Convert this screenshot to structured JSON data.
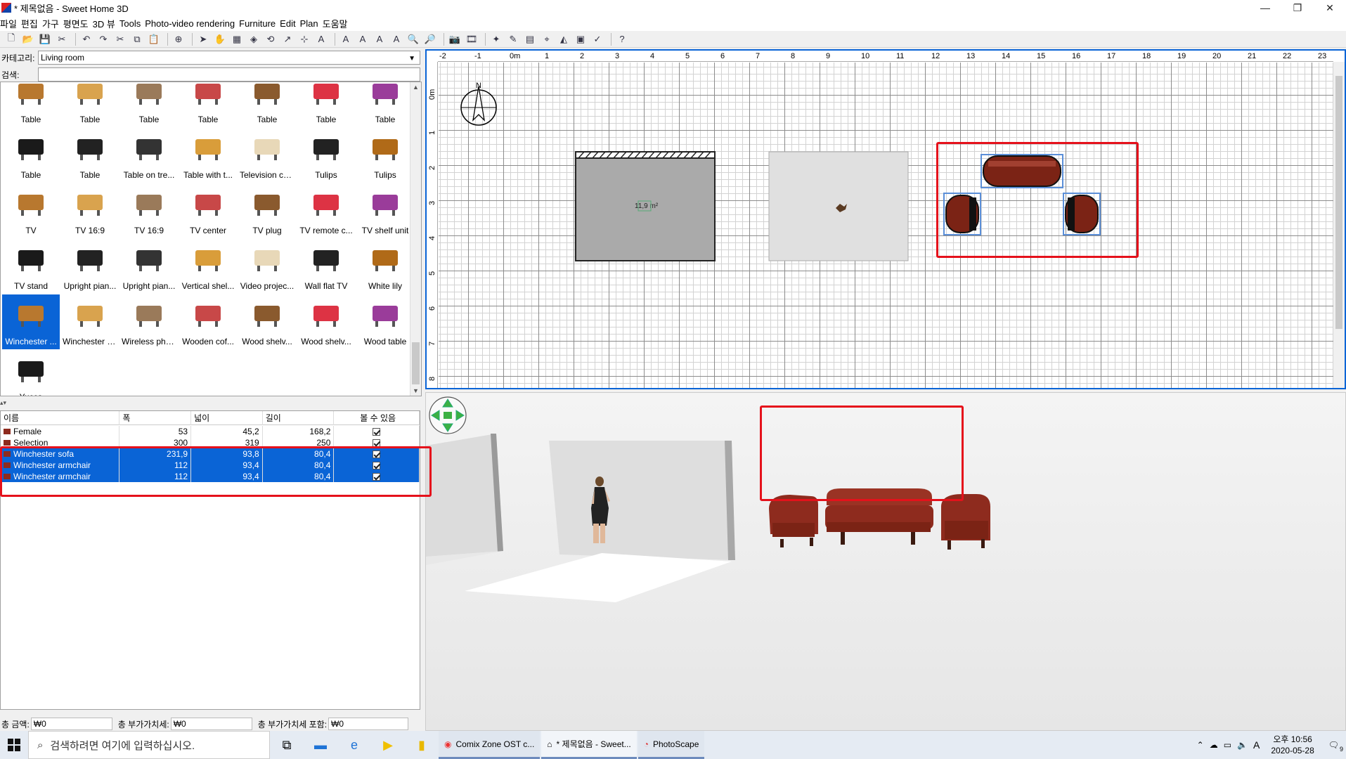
{
  "window": {
    "title": "* 제목없음 - Sweet Home 3D",
    "minimize": "—",
    "maximize": "❐",
    "close": "✕"
  },
  "menu": [
    "파일",
    "편집",
    "가구",
    "평면도",
    "3D 뷰",
    "Tools",
    "Photo-video rendering",
    "Furniture",
    "Edit",
    "Plan",
    "도움말"
  ],
  "left": {
    "category_label": "카테고리:",
    "category_value": "Living room",
    "search_label": "검색:",
    "search_value": ""
  },
  "catalog": [
    "Table",
    "Table",
    "Table",
    "Table",
    "Table",
    "Table",
    "Table",
    "Table",
    "Table",
    "Table on tre...",
    "Table with t...",
    "Television ca...",
    "Tulips",
    "Tulips",
    "TV",
    "TV 16:9",
    "TV 16:9",
    "TV center",
    "TV plug",
    "TV remote c...",
    "TV shelf unit",
    "TV stand",
    "Upright pian...",
    "Upright pian...",
    "Vertical shel...",
    "Video projec...",
    "Wall flat TV",
    "White lily",
    "Winchester ...",
    "Winchester s...",
    "Wireless pho...",
    "Wooden cof...",
    "Wood shelv...",
    "Wood shelv...",
    "Wood table",
    "Yucca"
  ],
  "catalog_selected_index": 28,
  "furniture_table": {
    "headers": [
      "이름",
      "폭",
      "넓이",
      "길이",
      "볼 수 있음"
    ],
    "rows": [
      {
        "name": "Female",
        "width": "53",
        "depth": "45,2",
        "height": "168,2",
        "visible": true,
        "selected": false
      },
      {
        "name": "Selection",
        "width": "300",
        "depth": "319",
        "height": "250",
        "visible": true,
        "selected": false
      },
      {
        "name": "Winchester sofa",
        "width": "231,9",
        "depth": "93,8",
        "height": "80,4",
        "visible": true,
        "selected": true
      },
      {
        "name": "Winchester armchair",
        "width": "112",
        "depth": "93,4",
        "height": "80,4",
        "visible": true,
        "selected": true
      },
      {
        "name": "Winchester armchair",
        "width": "112",
        "depth": "93,4",
        "height": "80,4",
        "visible": true,
        "selected": true
      }
    ]
  },
  "status": [
    {
      "label": "총 금액:",
      "value": "₩0"
    },
    {
      "label": "총 부가가치세:",
      "value": "₩0"
    },
    {
      "label": "총 부가가치세 포함:",
      "value": "₩0"
    }
  ],
  "plan": {
    "x_ticks": [
      "-2",
      "-1",
      "0m",
      "1",
      "2",
      "3",
      "4",
      "5",
      "6",
      "7",
      "8",
      "9",
      "10",
      "11",
      "12",
      "13",
      "14",
      "15",
      "16",
      "17",
      "18",
      "19",
      "20",
      "21",
      "22",
      "23"
    ],
    "y_ticks": [
      "0m",
      "1",
      "2",
      "3",
      "4",
      "5",
      "6",
      "7",
      "8"
    ],
    "room_area_label": "11,9 m²",
    "compass_label": "N"
  },
  "taskbar": {
    "search_placeholder": "검색하려면 여기에 입력하십시오.",
    "tasks": [
      "Comix Zone OST c...",
      "* 제목없음 - Sweet...",
      "PhotoScape"
    ],
    "time": "오후 10:56",
    "date": "2020-05-28",
    "ime": "A",
    "notifications": "9"
  },
  "colors": {
    "selection": "#0a64d6",
    "highlight_box": "#e5111b",
    "sofa": "#8e2b1e"
  }
}
